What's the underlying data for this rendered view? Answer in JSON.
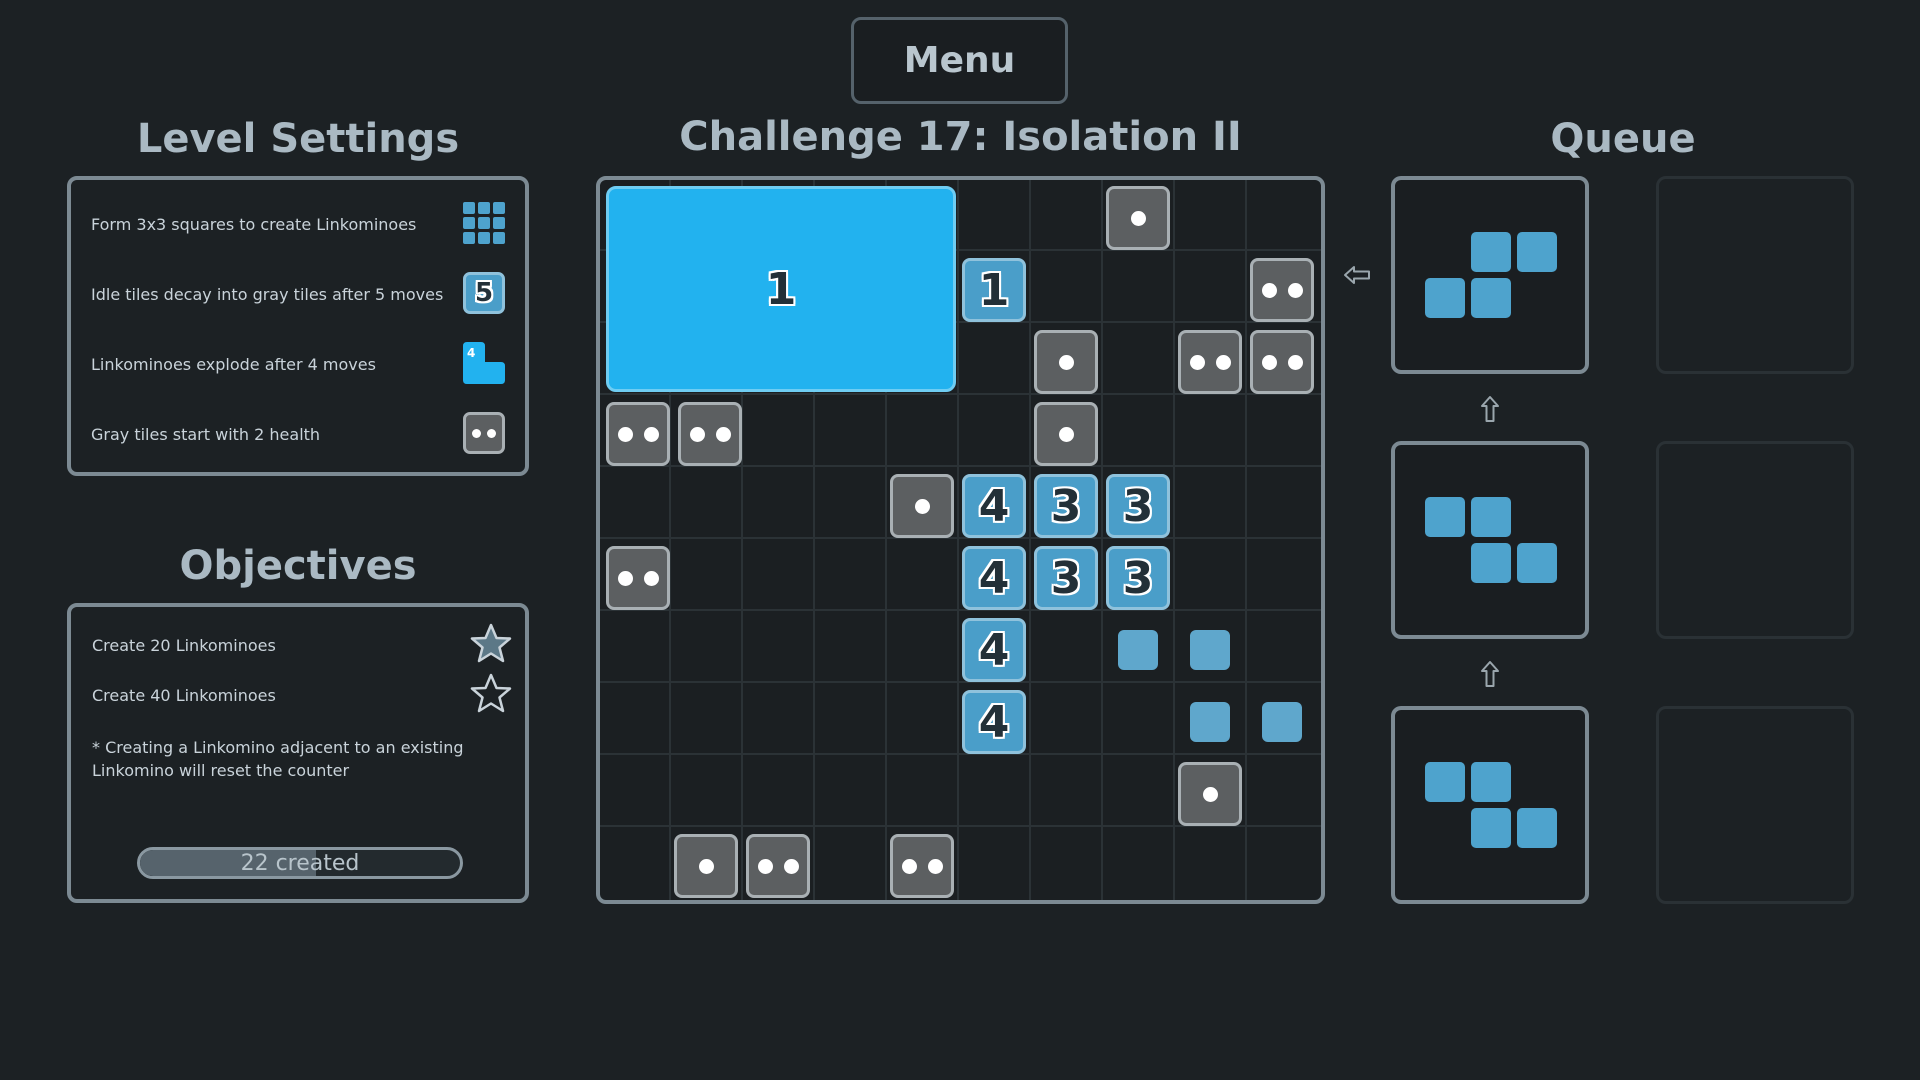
{
  "menu": {
    "label": "Menu"
  },
  "level_settings": {
    "title": "Level Settings",
    "items": [
      {
        "text": "Form 3x3 squares to create Linkominoes",
        "icon": "grid-icon"
      },
      {
        "text": "Idle tiles decay into gray tiles after 5 moves",
        "icon": "decay-icon",
        "icon_label": "5"
      },
      {
        "text": "Linkominoes explode after 4 moves",
        "icon": "linkomino-icon",
        "icon_label": "4"
      },
      {
        "text": "Gray tiles start with 2 health",
        "icon": "gray-tile-icon"
      }
    ]
  },
  "objectives": {
    "title": "Objectives",
    "items": [
      {
        "text": "Create 20 Linkominoes",
        "icon": "star-filled-icon",
        "completed": true
      },
      {
        "text": "Create 40 Linkominoes",
        "icon": "star-outline-icon",
        "completed": false
      }
    ],
    "note": "* Creating a Linkomino adjacent to an existing Linkomino will reset the counter",
    "progress": {
      "label": "22 created",
      "value": 22,
      "target": 40
    }
  },
  "board": {
    "title": "Challenge 17: Isolation II",
    "big_tile_label": "1",
    "numbers": [
      "1",
      "4",
      "3",
      "3",
      "4",
      "3",
      "3",
      "4",
      "4"
    ]
  },
  "queue": {
    "title": "Queue"
  },
  "colors": {
    "background": "#1c2124",
    "accent_blue": "#22b2ef",
    "tile_blue": "#4a9ec9",
    "gray_tile": "#5c5f61",
    "panel_border": "#7c8a93"
  }
}
